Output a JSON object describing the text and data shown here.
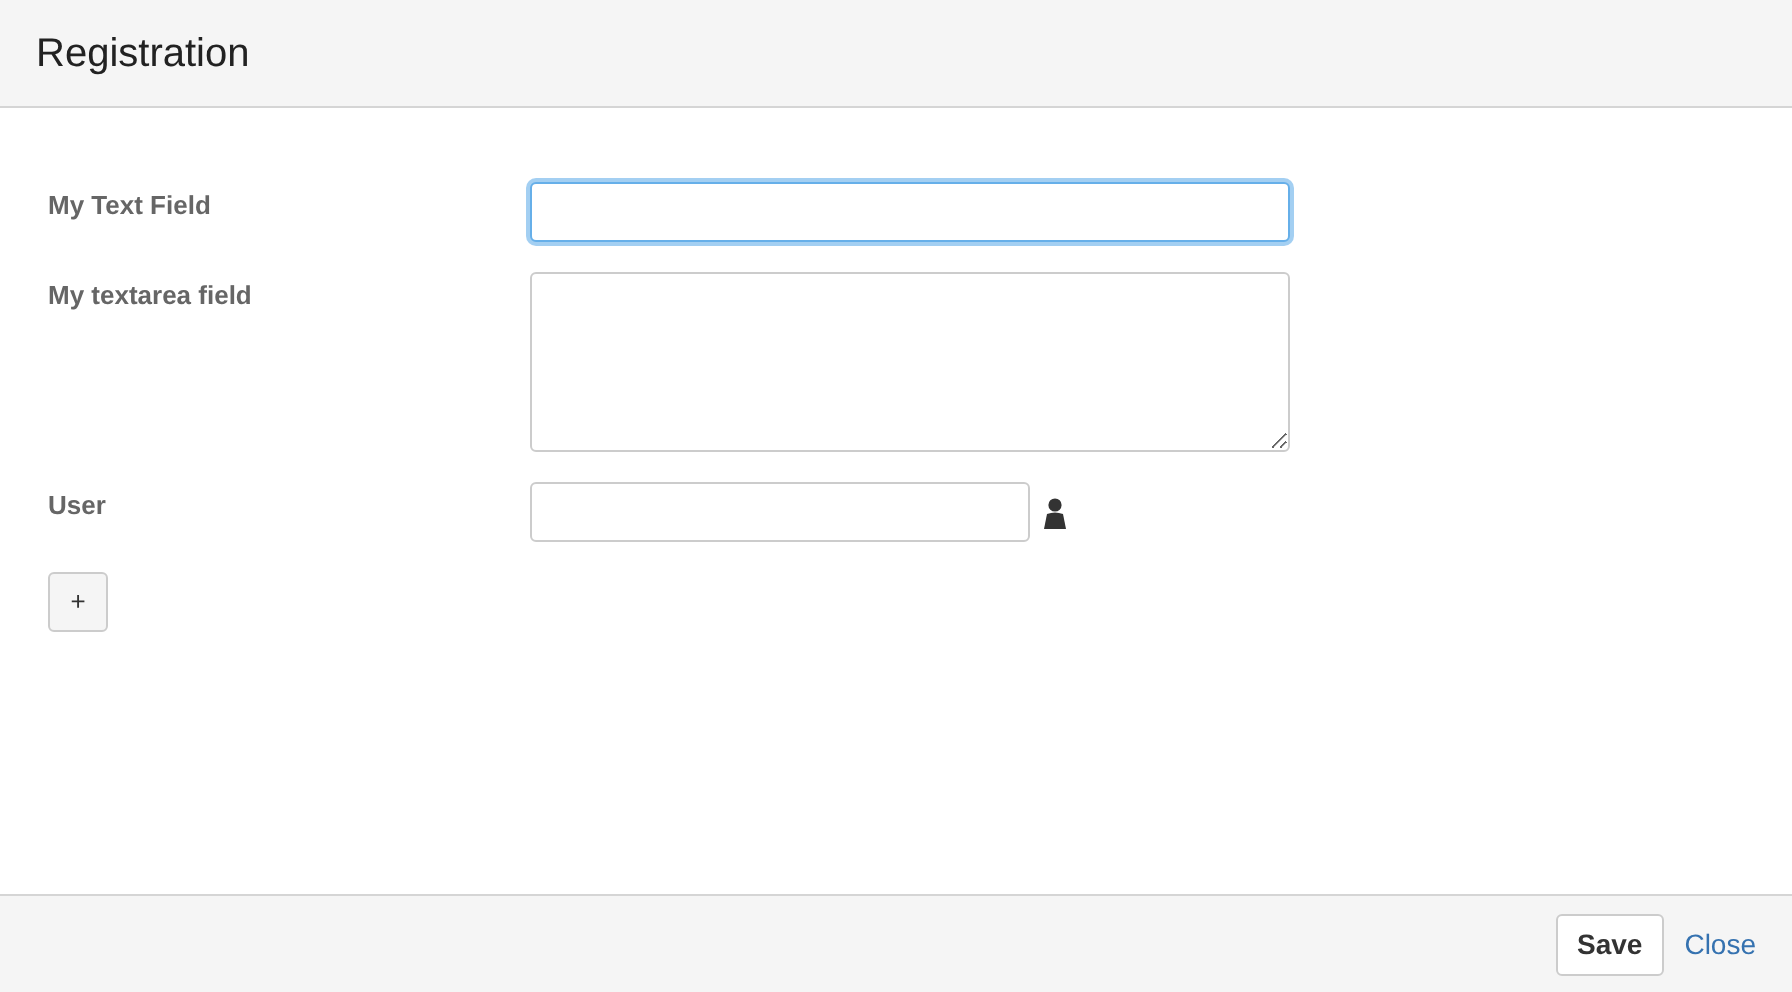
{
  "dialog": {
    "title": "Registration"
  },
  "fields": [
    {
      "kind": "text",
      "label": "My Text Field",
      "focused": true
    },
    {
      "kind": "textarea",
      "label": "My textarea field",
      "focused": false
    },
    {
      "kind": "user",
      "label": "User",
      "focused": false
    }
  ],
  "add_button": {
    "label": "+"
  },
  "footer": {
    "save": "Save",
    "close": "Close"
  }
}
